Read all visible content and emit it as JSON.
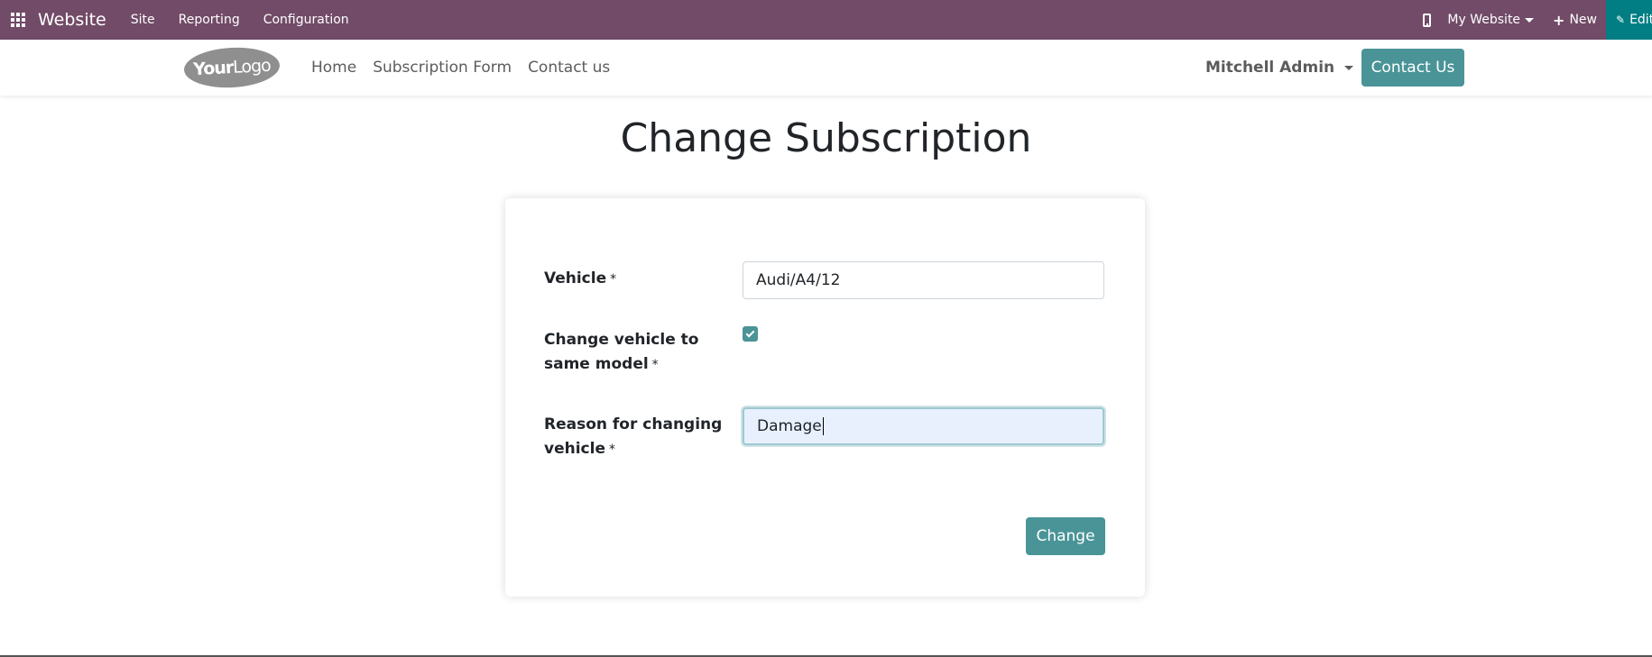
{
  "topbar": {
    "brand": "Website",
    "menu": [
      "Site",
      "Reporting",
      "Configuration"
    ],
    "website_switch": "My Website",
    "new_label": "New",
    "edit_label": "Edit",
    "color": "#714b67",
    "edit_color": "#017e84"
  },
  "header": {
    "logo_bold": "Your",
    "logo_light": "Logo",
    "nav": [
      "Home",
      "Subscription Form",
      "Contact us"
    ],
    "user": "Mitchell Admin",
    "contact_button": "Contact Us",
    "accent": "#4a9497"
  },
  "main": {
    "title": "Change Subscription",
    "form": {
      "vehicle_label": "Vehicle",
      "vehicle_value": "Audi/A4/12",
      "same_model_label_line1": "Change vehicle to",
      "same_model_label_line2": "same model",
      "same_model_checked": true,
      "reason_label_line1": "Reason for changing",
      "reason_label_line2": "vehicle",
      "reason_value": "Damage",
      "required_mark": "*",
      "submit_label": "Change"
    }
  }
}
